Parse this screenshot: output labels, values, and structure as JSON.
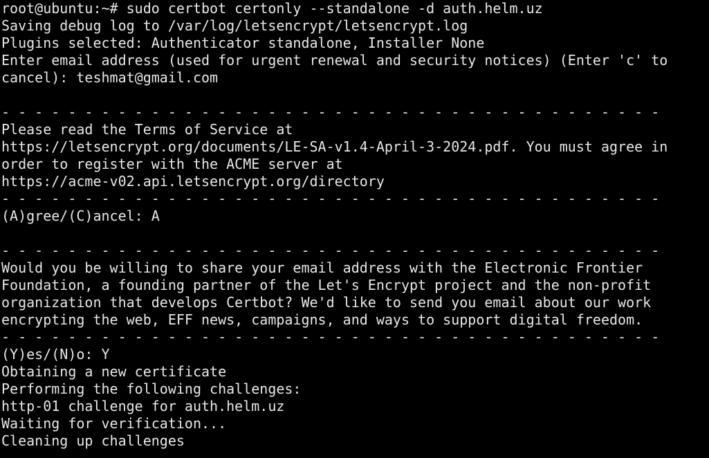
{
  "terminal": {
    "lines": [
      "root@ubuntu:~# sudo certbot certonly --standalone -d auth.helm.uz",
      "Saving debug log to /var/log/letsencrypt/letsencrypt.log",
      "Plugins selected: Authenticator standalone, Installer None",
      "Enter email address (used for urgent renewal and security notices) (Enter 'c' to",
      "cancel): teshmat@gmail.com",
      "",
      "- - - - - - - - - - - - - - - - - - - - - - - - - - - - - - - - - - - - - - - -",
      "Please read the Terms of Service at",
      "https://letsencrypt.org/documents/LE-SA-v1.4-April-3-2024.pdf. You must agree in",
      "order to register with the ACME server at",
      "https://acme-v02.api.letsencrypt.org/directory",
      "- - - - - - - - - - - - - - - - - - - - - - - - - - - - - - - - - - - - - - - -",
      "(A)gree/(C)ancel: A",
      "",
      "- - - - - - - - - - - - - - - - - - - - - - - - - - - - - - - - - - - - - - - -",
      "Would you be willing to share your email address with the Electronic Frontier",
      "Foundation, a founding partner of the Let's Encrypt project and the non-profit",
      "organization that develops Certbot? We'd like to send you email about our work",
      "encrypting the web, EFF news, campaigns, and ways to support digital freedom.",
      "- - - - - - - - - - - - - - - - - - - - - - - - - - - - - - - - - - - - - - - -",
      "(Y)es/(N)o: Y",
      "Obtaining a new certificate",
      "Performing the following challenges:",
      "http-01 challenge for auth.helm.uz",
      "Waiting for verification...",
      "Cleaning up challenges"
    ]
  }
}
